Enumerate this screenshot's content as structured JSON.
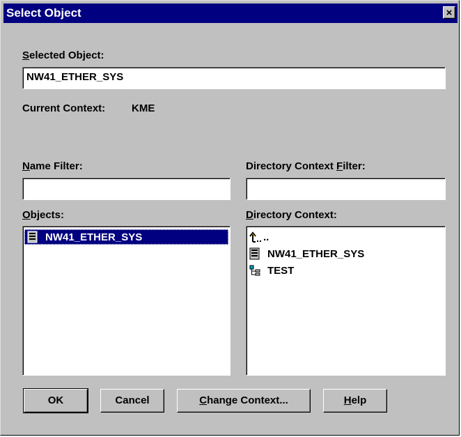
{
  "window": {
    "title": "Select Object",
    "close_glyph": "×"
  },
  "selected_object": {
    "label_access": "S",
    "label_rest": "elected Object:",
    "value": "NW41_ETHER_SYS"
  },
  "current_context": {
    "label": "Current Context:",
    "value": "KME"
  },
  "name_filter": {
    "label_access": "N",
    "label_rest": "ame Filter:",
    "value": ""
  },
  "directory_context_filter": {
    "label_pre": "Directory Context ",
    "label_access": "F",
    "label_rest": "ilter:",
    "value": ""
  },
  "objects": {
    "label_access": "O",
    "label_rest": "bjects:",
    "items": [
      {
        "label": "NW41_ETHER_SYS",
        "icon": "server-icon",
        "selected": true
      }
    ]
  },
  "directory_context": {
    "label_access": "D",
    "label_rest": "irectory Context:",
    "items": [
      {
        "label": "..",
        "icon": "parent-folder-icon"
      },
      {
        "label": "NW41_ETHER_SYS",
        "icon": "server-icon"
      },
      {
        "label": "TEST",
        "icon": "organizational-unit-icon"
      }
    ]
  },
  "buttons": {
    "ok": "OK",
    "cancel": "Cancel",
    "change_context_access": "C",
    "change_context_rest": "hange Context...",
    "help_access": "H",
    "help_rest": "elp"
  },
  "colors": {
    "titlebar": "#000080",
    "selection": "#000080",
    "face": "#c0c0c0"
  }
}
